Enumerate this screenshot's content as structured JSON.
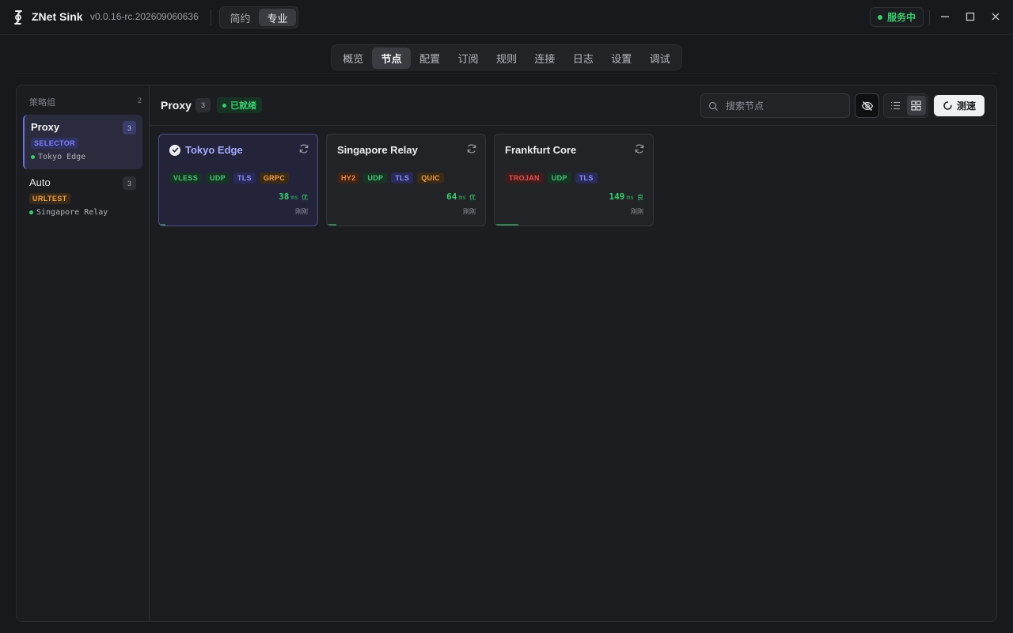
{
  "app": {
    "name": "ZNet Sink",
    "version": "v0.0.16-rc.202609060636",
    "modes": [
      "简约",
      "专业"
    ],
    "active_mode": "专业",
    "service_status": "服务中"
  },
  "nav": {
    "tabs": [
      "概览",
      "节点",
      "配置",
      "订阅",
      "规则",
      "连接",
      "日志",
      "设置",
      "调试"
    ],
    "active": "节点"
  },
  "sidebar": {
    "title": "策略组",
    "count": "2",
    "groups": [
      {
        "name": "Proxy",
        "count": "3",
        "type": "SELECTOR",
        "current": "Tokyo Edge"
      },
      {
        "name": "Auto",
        "count": "3",
        "type": "URLTEST",
        "current": "Singapore Relay"
      }
    ]
  },
  "content": {
    "title": "Proxy",
    "count": "3",
    "status": "已就绪",
    "search_placeholder": "搜索节点",
    "speed_test_label": "测速"
  },
  "nodes": [
    {
      "name": "Tokyo Edge",
      "tags": [
        "VLESS",
        "UDP",
        "TLS",
        "GRPC"
      ],
      "latency": "38",
      "unit": "ms",
      "grade": "优",
      "time": "刚刚",
      "latency_color": "#35d06b",
      "bar_fraction": 0.04
    },
    {
      "name": "Singapore Relay",
      "tags": [
        "HY2",
        "UDP",
        "TLS",
        "QUIC"
      ],
      "latency": "64",
      "unit": "ms",
      "grade": "优",
      "time": "刚刚",
      "latency_color": "#35d06b",
      "bar_fraction": 0.06
    },
    {
      "name": "Frankfurt Core",
      "tags": [
        "TROJAN",
        "UDP",
        "TLS"
      ],
      "latency": "149",
      "unit": "ms",
      "grade": "良",
      "time": "刚刚",
      "latency_color": "#35d06b",
      "bar_fraction": 0.15
    }
  ],
  "colors": {
    "accent": "#6e6fd8",
    "success": "#35d06b",
    "background": "#18191c"
  }
}
